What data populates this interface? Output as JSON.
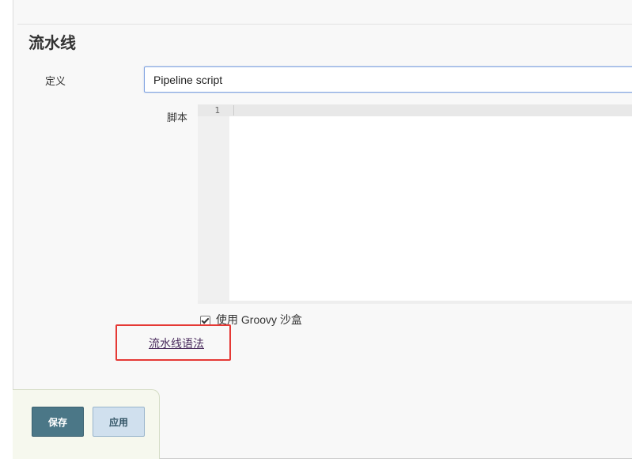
{
  "section": {
    "title": "流水线"
  },
  "definition": {
    "label": "定义",
    "selected": "Pipeline script"
  },
  "script": {
    "label": "脚本",
    "line_numbers": [
      "1"
    ]
  },
  "sandbox": {
    "label": "使用 Groovy 沙盒",
    "checked": true
  },
  "links": {
    "pipeline_syntax": "流水线语法"
  },
  "buttons": {
    "save": "保存",
    "apply": "应用"
  },
  "colors": {
    "highlight": "#e53935",
    "save_button": "#4b7787",
    "apply_button": "#d0e0ee",
    "link": "#4b2d5e"
  }
}
